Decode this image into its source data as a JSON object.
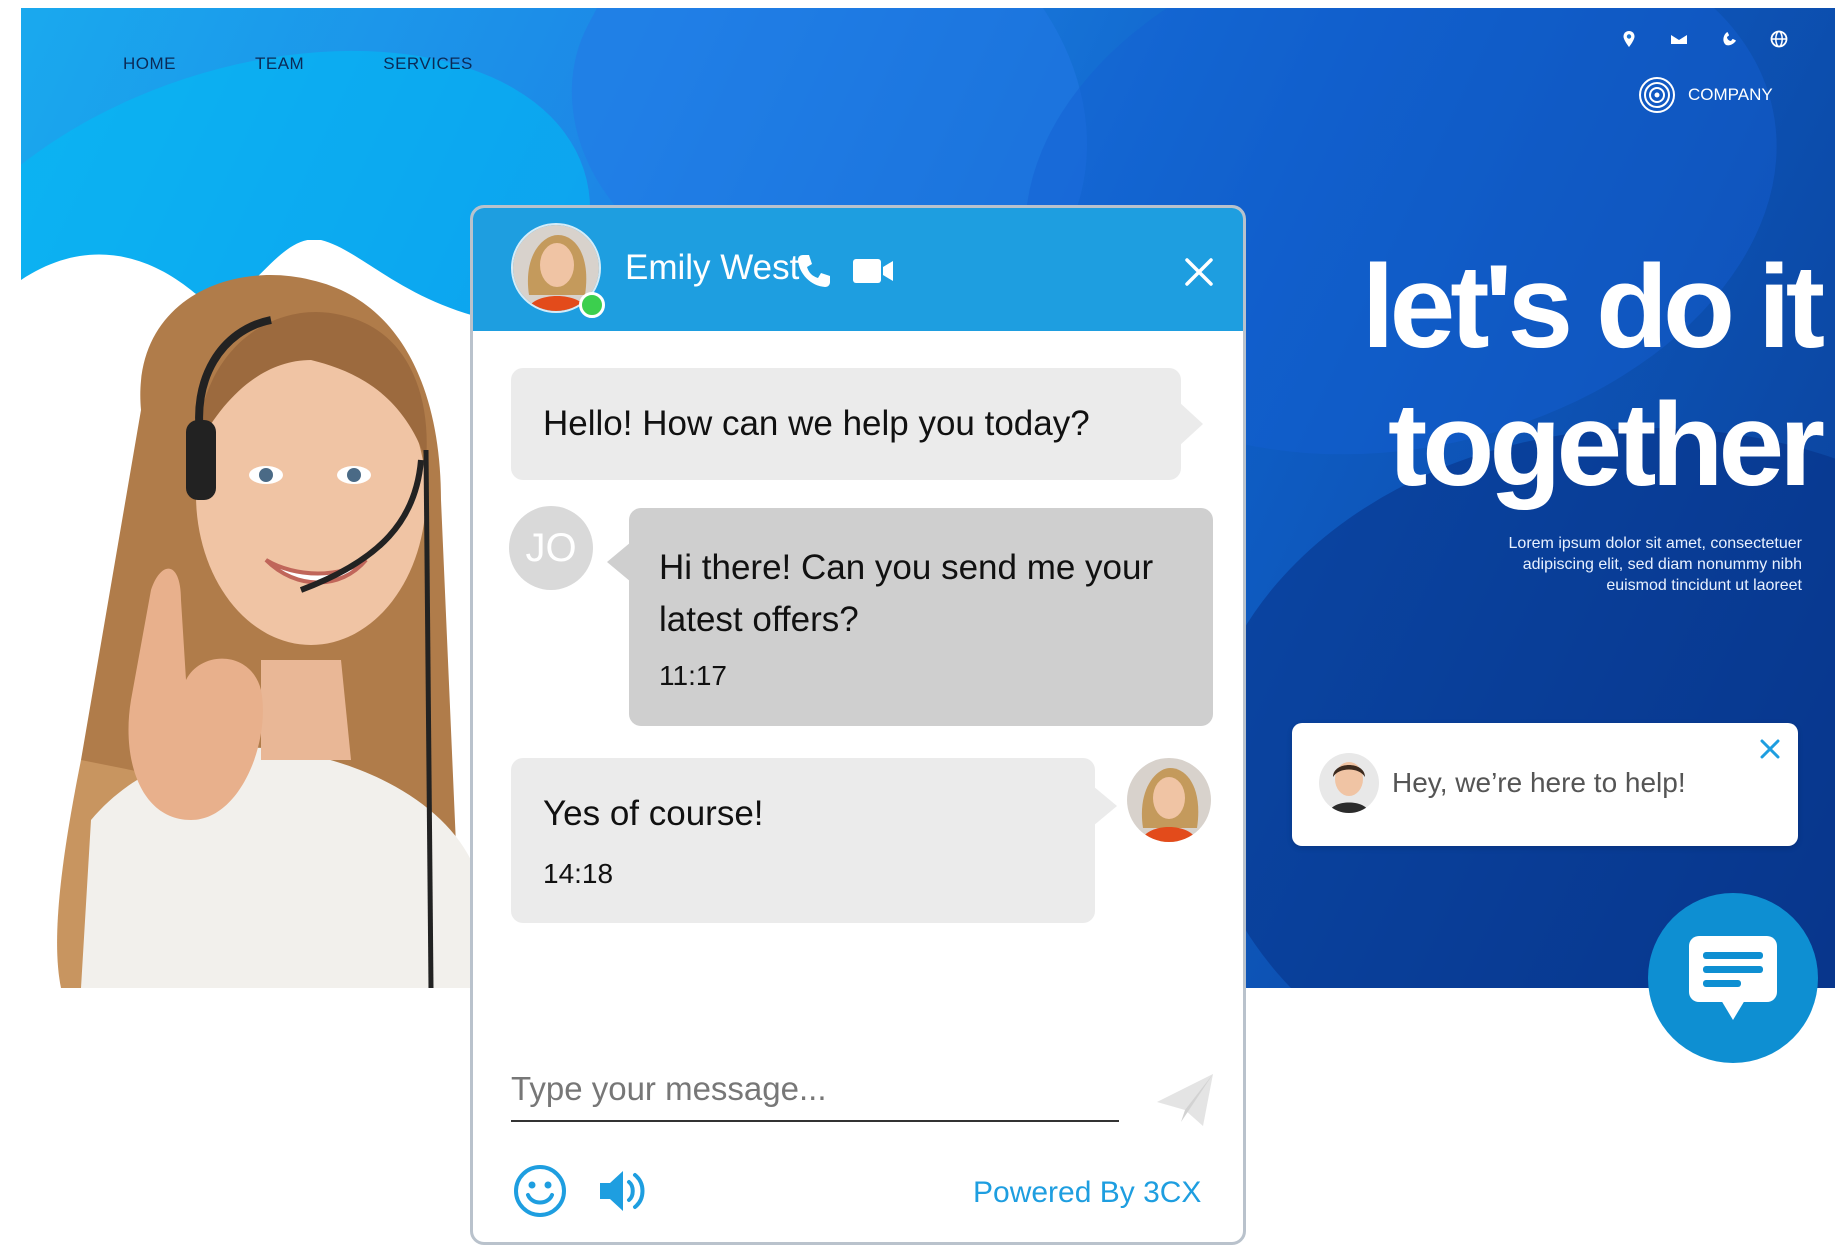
{
  "nav": {
    "items": [
      {
        "label": "HOME"
      },
      {
        "label": "TEAM"
      },
      {
        "label": "SERVICES"
      }
    ]
  },
  "top_icons": [
    "location-pin-icon",
    "mail-icon",
    "phone-icon",
    "globe-icon"
  ],
  "brand": {
    "logo_icon": "concentric-circles-icon",
    "name": "COMPANY"
  },
  "hero": {
    "headline_line1": "let's do it",
    "headline_line2": "together",
    "lorem_line1": "Lorem ipsum dolor sit amet, consectetuer",
    "lorem_line2": "adipiscing elit, sed diam nonummy nibh",
    "lorem_line3": "euismod tincidunt ut laoreet"
  },
  "popup": {
    "text": "Hey, we’re here to help!",
    "close_icon": "close-icon"
  },
  "launcher": {
    "icon": "chat-bubble-icon"
  },
  "chat": {
    "agent_name": "Emily West",
    "status": "online",
    "header_icons": [
      "phone-icon",
      "video-camera-icon",
      "close-icon"
    ],
    "messages": [
      {
        "from": "agent",
        "text": "Hello! How can we help you today?"
      },
      {
        "from": "user",
        "avatar_initials": "JO",
        "text": "Hi there! Can you send me your latest offers?",
        "time": "11:17"
      },
      {
        "from": "agent",
        "text": "Yes of course!",
        "time": "14:18"
      }
    ],
    "input_placeholder": "Type your message...",
    "footer": {
      "powered_by": "Powered By 3CX"
    }
  },
  "colors": {
    "accent": "#1e9ee0",
    "agent_bubble": "#ebebeb",
    "user_bubble": "#cfcfcf",
    "online": "#3ccf4e"
  }
}
